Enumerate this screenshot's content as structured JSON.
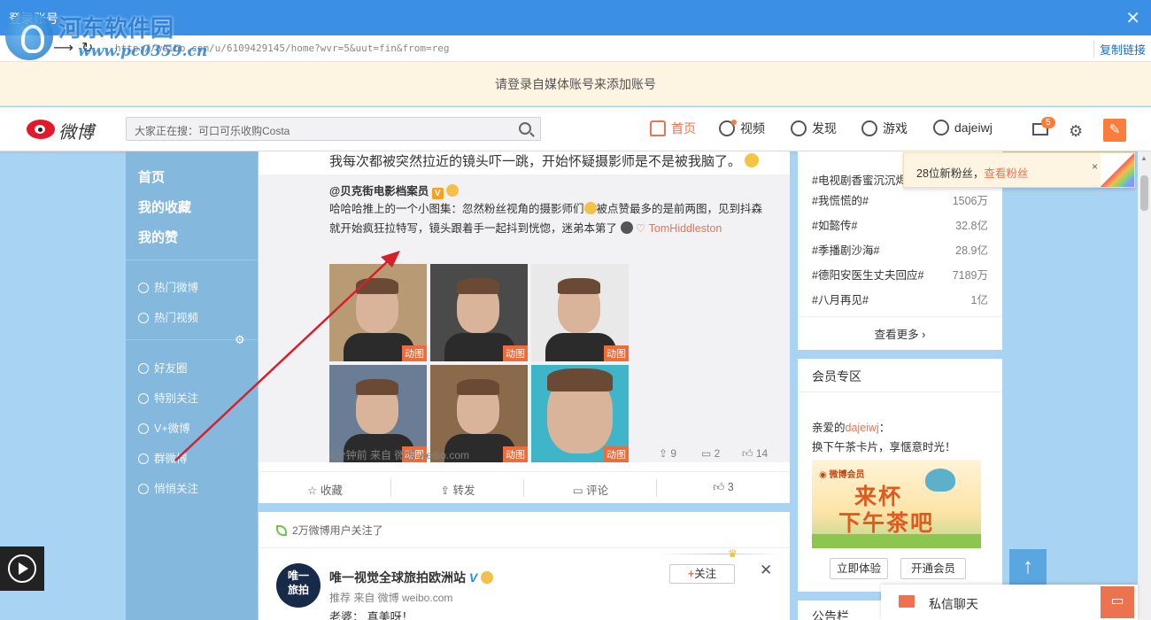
{
  "window": {
    "title": "登录账号",
    "close_icon": "close-icon"
  },
  "address_bar": {
    "url": "http://weibo.com/u/6109429145/home?wvr=5&uut=fin&from=reg",
    "copy_link": "复制链接"
  },
  "notice": "请登录自媒体账号来添加账号",
  "watermark": {
    "name": "河东软件园",
    "url": "www.pc0359.cn"
  },
  "header": {
    "logo_text": "微博",
    "search_placeholder": "大家正在搜：可口可乐收购Costa",
    "nav": [
      {
        "label": "首页",
        "icon": "home-icon",
        "active": true
      },
      {
        "label": "视频",
        "icon": "video-icon"
      },
      {
        "label": "发现",
        "icon": "compass-icon"
      },
      {
        "label": "游戏",
        "icon": "gamepad-icon"
      },
      {
        "label": "dajeiwj",
        "icon": "user-icon"
      }
    ],
    "mail_badge": "5"
  },
  "left_nav": {
    "main": [
      "首页",
      "我的收藏",
      "我的赞"
    ],
    "group1": [
      "热门微博",
      "热门视频"
    ],
    "group2": [
      "好友圈",
      "特别关注",
      "V+微博",
      "群微博",
      "悄悄关注"
    ]
  },
  "feed": {
    "post1": {
      "text": "我每次都被突然拉近的镜头吓一跳，开始怀疑摄影师是不是被我脑了。",
      "repost_author": "@贝克街电影档案员",
      "repost_text_1": "哈哈哈推上的一个小图集：忽然粉丝视角的摄影师们",
      "repost_text_2": "被点赞最多的是前两图，见到抖森就开始疯狂拉特写，镜头跟着手一起抖到恍惚，迷弟本第了",
      "repost_mention": "TomHiddleston",
      "gif_tag": "动图",
      "repost_meta": "4分钟前 来自 微博 weibo.com",
      "repost_stats": {
        "forward": "9",
        "comment": "2",
        "like": "14"
      },
      "actions": {
        "collect": "收藏",
        "forward": "转发",
        "comment": "评论",
        "like": "3"
      }
    },
    "post2": {
      "header": "2万微博用户关注了",
      "avatar_text_1": "唯一",
      "avatar_text_2": "旅拍",
      "name": "唯一视觉全球旅拍欧洲站",
      "follow": "关注",
      "source": "推荐 来自 微博 weibo.com",
      "body": "老婆：  真美呀！"
    }
  },
  "right": {
    "hot": [
      {
        "topic": "#电视剧香蜜沉沉烬如霜#",
        "value": ""
      },
      {
        "topic": "#我慌慌的#",
        "value": "1506万"
      },
      {
        "topic": "#如懿传#",
        "value": "32.8亿"
      },
      {
        "topic": "#季播剧沙海#",
        "value": "28.9亿"
      },
      {
        "topic": "#德阳安医生丈夫回应#",
        "value": "7189万"
      },
      {
        "topic": "#八月再见#",
        "value": "1亿"
      }
    ],
    "see_more": "查看更多",
    "member": {
      "title": "会员专区",
      "greet_pre": "亲爱的",
      "greet_user": "dajeiwj",
      "greet_post": "：",
      "line2": "换下午茶卡片，享惬意时光！",
      "banner_logo": "微博会员",
      "banner_line1": "来杯",
      "banner_line2": "下午茶吧",
      "btn_experience": "立即体验",
      "btn_open": "开通会员"
    },
    "announce": "公告栏"
  },
  "tip": {
    "text": "28位新粉丝，",
    "link": "查看粉丝",
    "close": "×"
  },
  "chat": {
    "label": "私信聊天"
  }
}
